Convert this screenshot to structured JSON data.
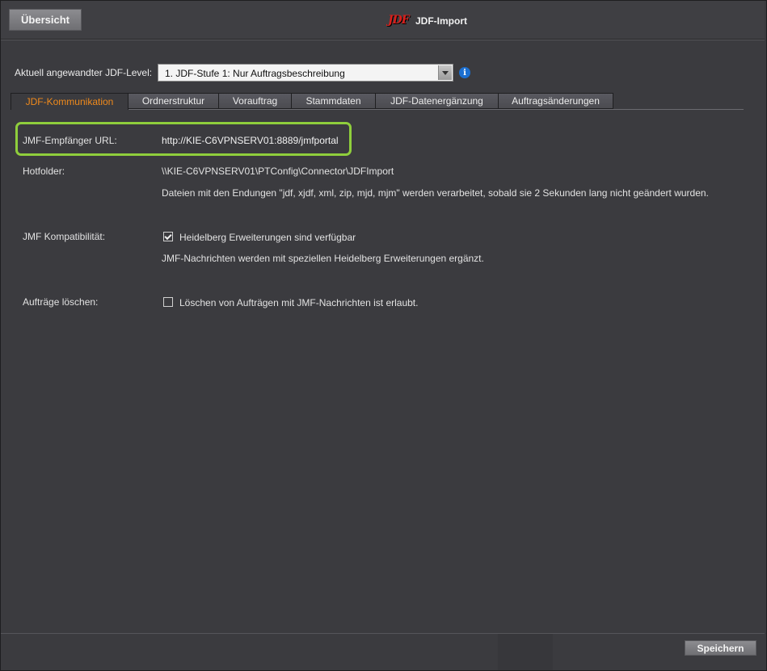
{
  "header": {
    "overview_label": "Übersicht",
    "logo_text": "JDF",
    "title": "JDF-Import"
  },
  "level": {
    "label": "Aktuell angewandter JDF-Level:",
    "selected": "1. JDF-Stufe 1: Nur Auftragsbeschreibung",
    "info_icon": "info-icon"
  },
  "tabs": [
    {
      "label": "JDF-Kommunikation",
      "active": true
    },
    {
      "label": "Ordnerstruktur",
      "active": false
    },
    {
      "label": "Vorauftrag",
      "active": false
    },
    {
      "label": "Stammdaten",
      "active": false
    },
    {
      "label": "JDF-Datenergänzung",
      "active": false
    },
    {
      "label": "Auftragsänderungen",
      "active": false
    }
  ],
  "content": {
    "jmf_url_label": "JMF-Empfänger URL:",
    "jmf_url_value": "http://KIE-C6VPNSERV01:8889/jmfportal",
    "hotfolder_label": "Hotfolder:",
    "hotfolder_path": "\\\\KIE-C6VPNSERV01\\PTConfig\\Connector\\JDFImport",
    "hotfolder_desc": "Dateien mit den Endungen \"jdf, xjdf, xml, zip, mjd, mjm\" werden verarbeitet, sobald sie 2 Sekunden lang nicht geändert wurden.",
    "jmf_compat_label": "JMF Kompatibilität:",
    "heidelberg_checkbox_label": "Heidelberg Erweiterungen sind verfügbar",
    "heidelberg_checked": true,
    "heidelberg_desc": "JMF-Nachrichten werden mit speziellen Heidelberg Erweiterungen ergänzt.",
    "delete_label": "Aufträge löschen:",
    "delete_checkbox_label": "Löschen von Aufträgen mit JMF-Nachrichten ist erlaubt.",
    "delete_checked": false
  },
  "footer": {
    "save_label": "Speichern"
  },
  "colors": {
    "active_tab": "#f08a1c",
    "highlight": "#8fce3c",
    "background": "#3b3b3f"
  }
}
